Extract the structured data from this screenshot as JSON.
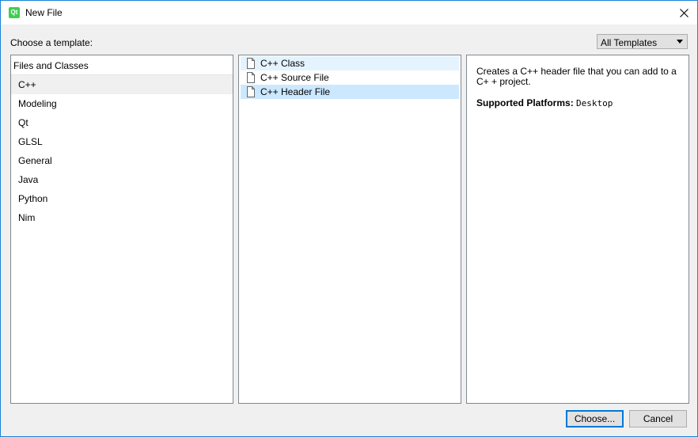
{
  "window": {
    "title": "New File",
    "app_icon_text": "Qt"
  },
  "header": {
    "choose_label": "Choose a template:",
    "filter_value": "All Templates"
  },
  "categories": {
    "header": "Files and Classes",
    "items": [
      {
        "label": "C++",
        "selected": true
      },
      {
        "label": "Modeling"
      },
      {
        "label": "Qt"
      },
      {
        "label": "GLSL"
      },
      {
        "label": "General"
      },
      {
        "label": "Java"
      },
      {
        "label": "Python"
      },
      {
        "label": "Nim"
      }
    ]
  },
  "templates": {
    "items": [
      {
        "label": "C++ Class",
        "state": "hover",
        "icon": "file-icon"
      },
      {
        "label": "C++ Source File",
        "icon": "file-icon"
      },
      {
        "label": "C++ Header File",
        "state": "selected",
        "icon": "file-icon"
      }
    ]
  },
  "details": {
    "description": "Creates a C++ header file that you can add to a C+ + project.",
    "platforms_label": "Supported Platforms",
    "platforms_value": "Desktop"
  },
  "buttons": {
    "choose": "Choose...",
    "cancel": "Cancel"
  },
  "colors": {
    "accent": "#0078d7",
    "selection": "#cce8ff",
    "hover": "#e5f3ff",
    "qt_green": "#41cd52"
  }
}
